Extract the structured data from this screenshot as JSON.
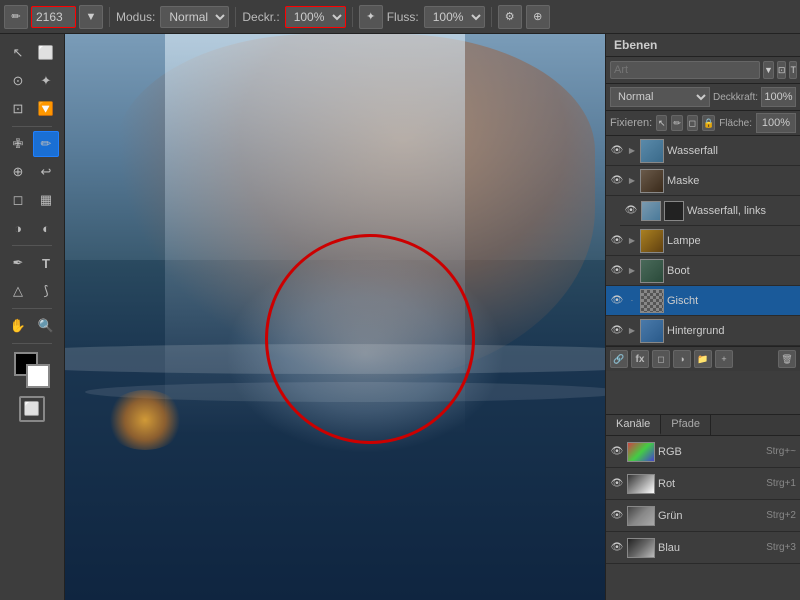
{
  "toolbar": {
    "brush_size": "2163",
    "mode_label": "Modus:",
    "mode_value": "Normal",
    "opacity_label": "Deckr.:",
    "opacity_value": "100%",
    "flow_label": "Fluss:",
    "flow_value": "100%"
  },
  "tools": [
    {
      "name": "move",
      "icon": "↖",
      "active": false
    },
    {
      "name": "select-rect",
      "icon": "⬜",
      "active": false
    },
    {
      "name": "lasso",
      "icon": "⊙",
      "active": false
    },
    {
      "name": "quick-select",
      "icon": "✦",
      "active": false
    },
    {
      "name": "crop",
      "icon": "⊡",
      "active": false
    },
    {
      "name": "eyedropper",
      "icon": "✒",
      "active": false
    },
    {
      "name": "spot-heal",
      "icon": "✙",
      "active": false
    },
    {
      "name": "brush",
      "icon": "✏",
      "active": true
    },
    {
      "name": "stamp",
      "icon": "⊕",
      "active": false
    },
    {
      "name": "eraser",
      "icon": "◻",
      "active": false
    },
    {
      "name": "gradient",
      "icon": "▦",
      "active": false
    },
    {
      "name": "dodge",
      "icon": "◑",
      "active": false
    },
    {
      "name": "pen",
      "icon": "✒",
      "active": false
    },
    {
      "name": "text",
      "icon": "T",
      "active": false
    },
    {
      "name": "shape",
      "icon": "△",
      "active": false
    },
    {
      "name": "hand",
      "icon": "✋",
      "active": false
    },
    {
      "name": "zoom",
      "icon": "⊕",
      "active": false
    }
  ],
  "layers_panel": {
    "title": "Ebenen",
    "search_placeholder": "Art",
    "mode_label": "Normal",
    "opacity_label": "Deckkraft:",
    "opacity_value": "100%",
    "fix_label": "Fixieren:",
    "flaeche_label": "Fläche:",
    "layers": [
      {
        "name": "Wasserfall",
        "type": "group",
        "visible": true,
        "selected": false,
        "indent": false
      },
      {
        "name": "Maske",
        "type": "group",
        "visible": true,
        "selected": false,
        "indent": false
      },
      {
        "name": "Wasserfall, links",
        "type": "image",
        "visible": true,
        "selected": false,
        "indent": true
      },
      {
        "name": "Lampe",
        "type": "group",
        "visible": true,
        "selected": false,
        "indent": false
      },
      {
        "name": "Boot",
        "type": "group",
        "visible": true,
        "selected": false,
        "indent": false
      },
      {
        "name": "Gischt",
        "type": "layer",
        "visible": true,
        "selected": true,
        "indent": false
      },
      {
        "name": "Hintergrund",
        "type": "group",
        "visible": true,
        "selected": false,
        "indent": false
      }
    ]
  },
  "channels_panel": {
    "tabs": [
      "Kanäle",
      "Pfade"
    ],
    "active_tab": "Kanäle",
    "channels": [
      {
        "name": "RGB",
        "shortcut": "Strg+~",
        "type": "rgb"
      },
      {
        "name": "Rot",
        "shortcut": "Strg+1",
        "type": "red"
      },
      {
        "name": "Grün",
        "shortcut": "Strg+2",
        "type": "green"
      },
      {
        "name": "Blau",
        "shortcut": "Strg+3",
        "type": "blue"
      }
    ]
  }
}
